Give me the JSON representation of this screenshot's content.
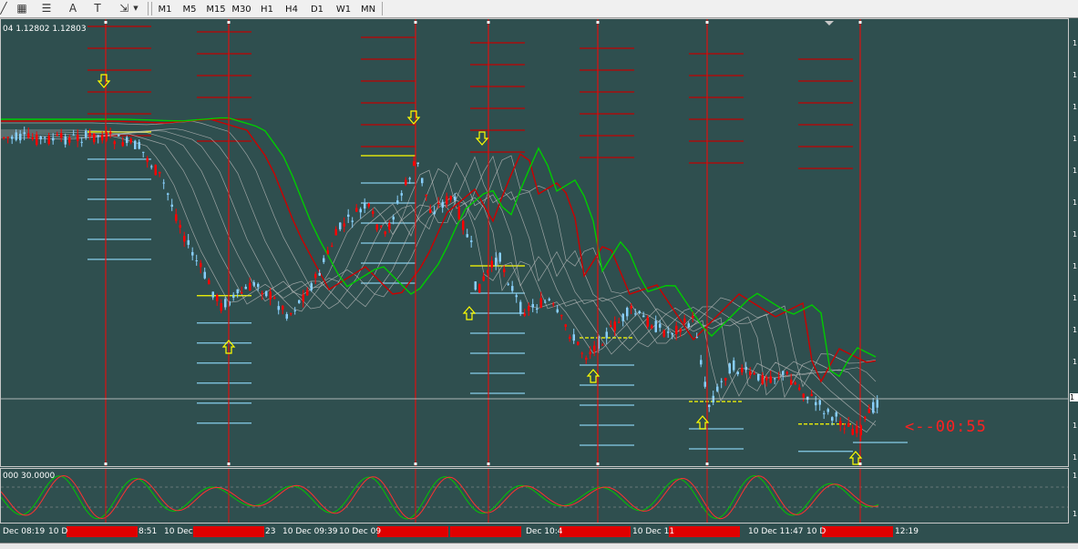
{
  "toolbar": {
    "icons": [
      "line-study-icon",
      "fibonacci-fan-icon",
      "fibonacci-retracement-icon",
      "text-label-icon",
      "text-icon",
      "arrow-drawing-icon"
    ],
    "glyphs": {
      "text": "A",
      "textbox": "T"
    },
    "timeframes": [
      "M1",
      "M5",
      "M15",
      "M30",
      "H1",
      "H4",
      "D1",
      "W1",
      "MN"
    ]
  },
  "chart_header": {
    "prices": "04 1.12802 1.12803"
  },
  "oscillator_header": {
    "levels": "000 30.0000"
  },
  "countdown": {
    "text": "<--00:55"
  },
  "time_axis": {
    "labels": [
      "Dec 08:19",
      "10 D",
      "8:51",
      "10 Dec",
      "23",
      "10 Dec 09:39",
      "10 Dec 09",
      "Dec 10:4",
      "10 Dec 11",
      "10 Dec 11:47",
      "10 D",
      "12:19"
    ],
    "highlighted_count": 8
  },
  "colors": {
    "background": "#2f4f4f",
    "bear_candle": "#ff0000",
    "bull_candle": "#87cefa",
    "ribbon": "#c0c0c0",
    "ma_slow_red": "#cc0000",
    "ma_green": "#00cc00",
    "resistance": "#c00000",
    "support": "#87ceeb",
    "pivot": "#ffff00",
    "signal_arrow": "#ffff00",
    "oscillator_green": "#00c800",
    "oscillator_red": "#ff3030"
  },
  "chart_data": {
    "type": "candlestick",
    "instrument_last": [
      1.12802,
      1.12803
    ],
    "signals": [
      "down",
      "up",
      "down",
      "up",
      "down",
      "up",
      "up",
      "up"
    ],
    "oscillator_levels": [
      30
    ]
  }
}
